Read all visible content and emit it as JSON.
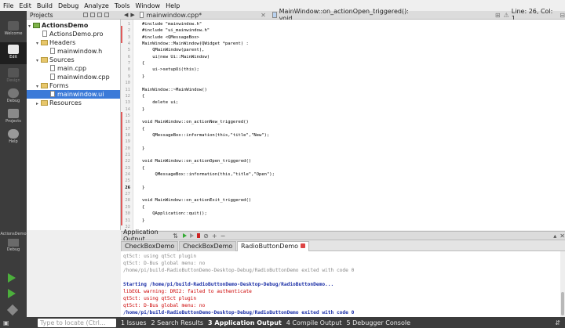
{
  "menu": [
    "File",
    "Edit",
    "Build",
    "Debug",
    "Analyze",
    "Tools",
    "Window",
    "Help"
  ],
  "modes": [
    "Welcome",
    "Edit",
    "Design",
    "Debug",
    "Projects",
    "Help"
  ],
  "kit": {
    "project": "ActionsDemo",
    "config": "Debug"
  },
  "projects": {
    "selector": "Projects",
    "tree": [
      {
        "label": "ActionsDemo",
        "kind": "project"
      },
      {
        "label": "ActionsDemo.pro",
        "kind": "file"
      },
      {
        "label": "Headers",
        "kind": "folder"
      },
      {
        "label": "mainwindow.h",
        "kind": "file"
      },
      {
        "label": "Sources",
        "kind": "folder"
      },
      {
        "label": "main.cpp",
        "kind": "file"
      },
      {
        "label": "mainwindow.cpp",
        "kind": "file"
      },
      {
        "label": "Forms",
        "kind": "folder"
      },
      {
        "label": "mainwindow.ui",
        "kind": "file",
        "selected": true
      },
      {
        "label": "Resources",
        "kind": "folder"
      }
    ]
  },
  "editor": {
    "file": "mainwindow.cpp*",
    "symbol": "MainWindow::on_actionOpen_triggered(): void",
    "position": "Line: 26, Col: 1",
    "current_line": "26",
    "lines": [
      "#include \"mainwindow.h\"",
      "#include \"ui_mainwindow.h\"",
      "#include <QMessageBox>",
      "MainWindow::MainWindow(QWidget *parent) :",
      "    QMainWindow(parent),",
      "    ui(new Ui::MainWindow)",
      "{",
      "    ui->setupUi(this);",
      "}",
      "",
      "MainWindow::~MainWindow()",
      "{",
      "    delete ui;",
      "}",
      "",
      "void MainWindow::on_actionNew_triggered()",
      "{",
      "    QMessageBox::information(this,\"title\",\"New\");",
      "",
      "}",
      "",
      "void MainWindow::on_actionOpen_triggered()",
      "{",
      "     QMessageBox::information(this,\"title\",\"Open\");",
      "",
      "}",
      "",
      "void MainWindow::on_actionExit_triggered()",
      "{",
      "    QApplication::quit();",
      "}",
      ""
    ]
  },
  "output": {
    "title": "Application Output",
    "tabs": [
      "CheckBoxDemo",
      "CheckBoxDemo",
      "RadioButtonDemo"
    ],
    "active_tab": 2,
    "lines": [
      {
        "text": "qt5ct: using qt5ct plugin",
        "style": "grey"
      },
      {
        "text": "qt5ct: D-Bus global menu: no",
        "style": "grey"
      },
      {
        "text": "/home/pi/build-RadioButtonDemo-Desktop-Debug/RadioButtonDemo exited with code 0",
        "style": "grey"
      },
      {
        "text": "",
        "style": "grey"
      },
      {
        "text": "Starting /home/pi/build-RadioButtonDemo-Desktop-Debug/RadioButtonDemo...",
        "style": "blue"
      },
      {
        "text": "libEGL warning: DRI2: failed to authenticate",
        "style": "red"
      },
      {
        "text": "qt5ct: using qt5ct plugin",
        "style": "red"
      },
      {
        "text": "qt5ct: D-Bus global menu: no",
        "style": "red"
      },
      {
        "text": "/home/pi/build-RadioButtonDemo-Desktop-Debug/RadioButtonDemo exited with code 0",
        "style": "blue"
      }
    ]
  },
  "statusbar": {
    "locate_placeholder": "Type to locate (Ctrl...",
    "panes": [
      "1 Issues",
      "2 Search Results",
      "3 Application Output",
      "4 Compile Output",
      "5 Debugger Console"
    ]
  },
  "colors": {
    "accent": "#3b7ad8",
    "sidebar": "#3c3c3c",
    "changed_marker": "#e05a5a"
  }
}
